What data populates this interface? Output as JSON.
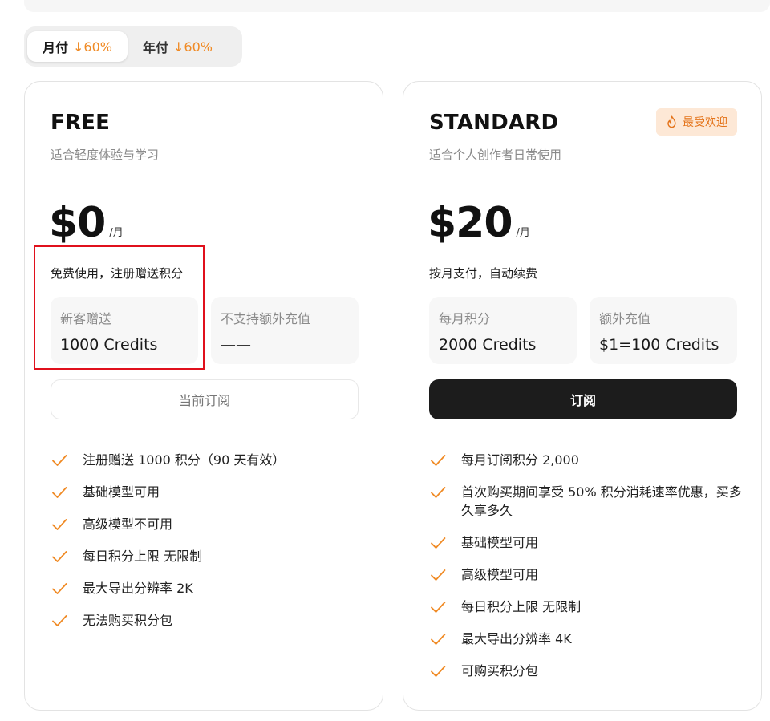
{
  "billing_toggle": {
    "monthly": {
      "label": "月付",
      "discount": "↓60%"
    },
    "yearly": {
      "label": "年付",
      "discount": "↓60%"
    },
    "active": "monthly"
  },
  "plans": [
    {
      "name": "FREE",
      "description": "适合轻度体验与学习",
      "price": "$0",
      "price_unit": "/月",
      "price_note": "免费使用，注册赠送积分",
      "info_boxes": [
        {
          "label": "新客赠送",
          "value": "1000 Credits"
        },
        {
          "label": "不支持额外充值",
          "value": "——"
        }
      ],
      "button_label": "当前订阅",
      "features": [
        "注册赠送 1000 积分（90 天有效）",
        "基础模型可用",
        "高级模型不可用",
        "每日积分上限 无限制",
        "最大导出分辨率 2K",
        "无法购买积分包"
      ]
    },
    {
      "name": "STANDARD",
      "description": "适合个人创作者日常使用",
      "badge": "最受欢迎",
      "price": "$20",
      "price_unit": "/月",
      "price_note": "按月支付，自动续费",
      "info_boxes": [
        {
          "label": "每月积分",
          "value": "2000 Credits"
        },
        {
          "label": "额外充值",
          "value": "$1=100 Credits"
        }
      ],
      "button_label": "订阅",
      "features": [
        "每月订阅积分 2,000",
        "首次购买期间享受 50% 积分消耗速率优惠，买多久享多久",
        "基础模型可用",
        "高级模型可用",
        "每日积分上限 无限制",
        "最大导出分辨率 4K",
        "可购买积分包"
      ]
    }
  ],
  "colors": {
    "accent": "#f08a24",
    "highlight_box": "#e0101c",
    "primary_button": "#1c1c1c",
    "badge_bg": "#fde8d6"
  },
  "icons": {
    "feature_check": "check-icon",
    "badge": "flame-icon"
  }
}
